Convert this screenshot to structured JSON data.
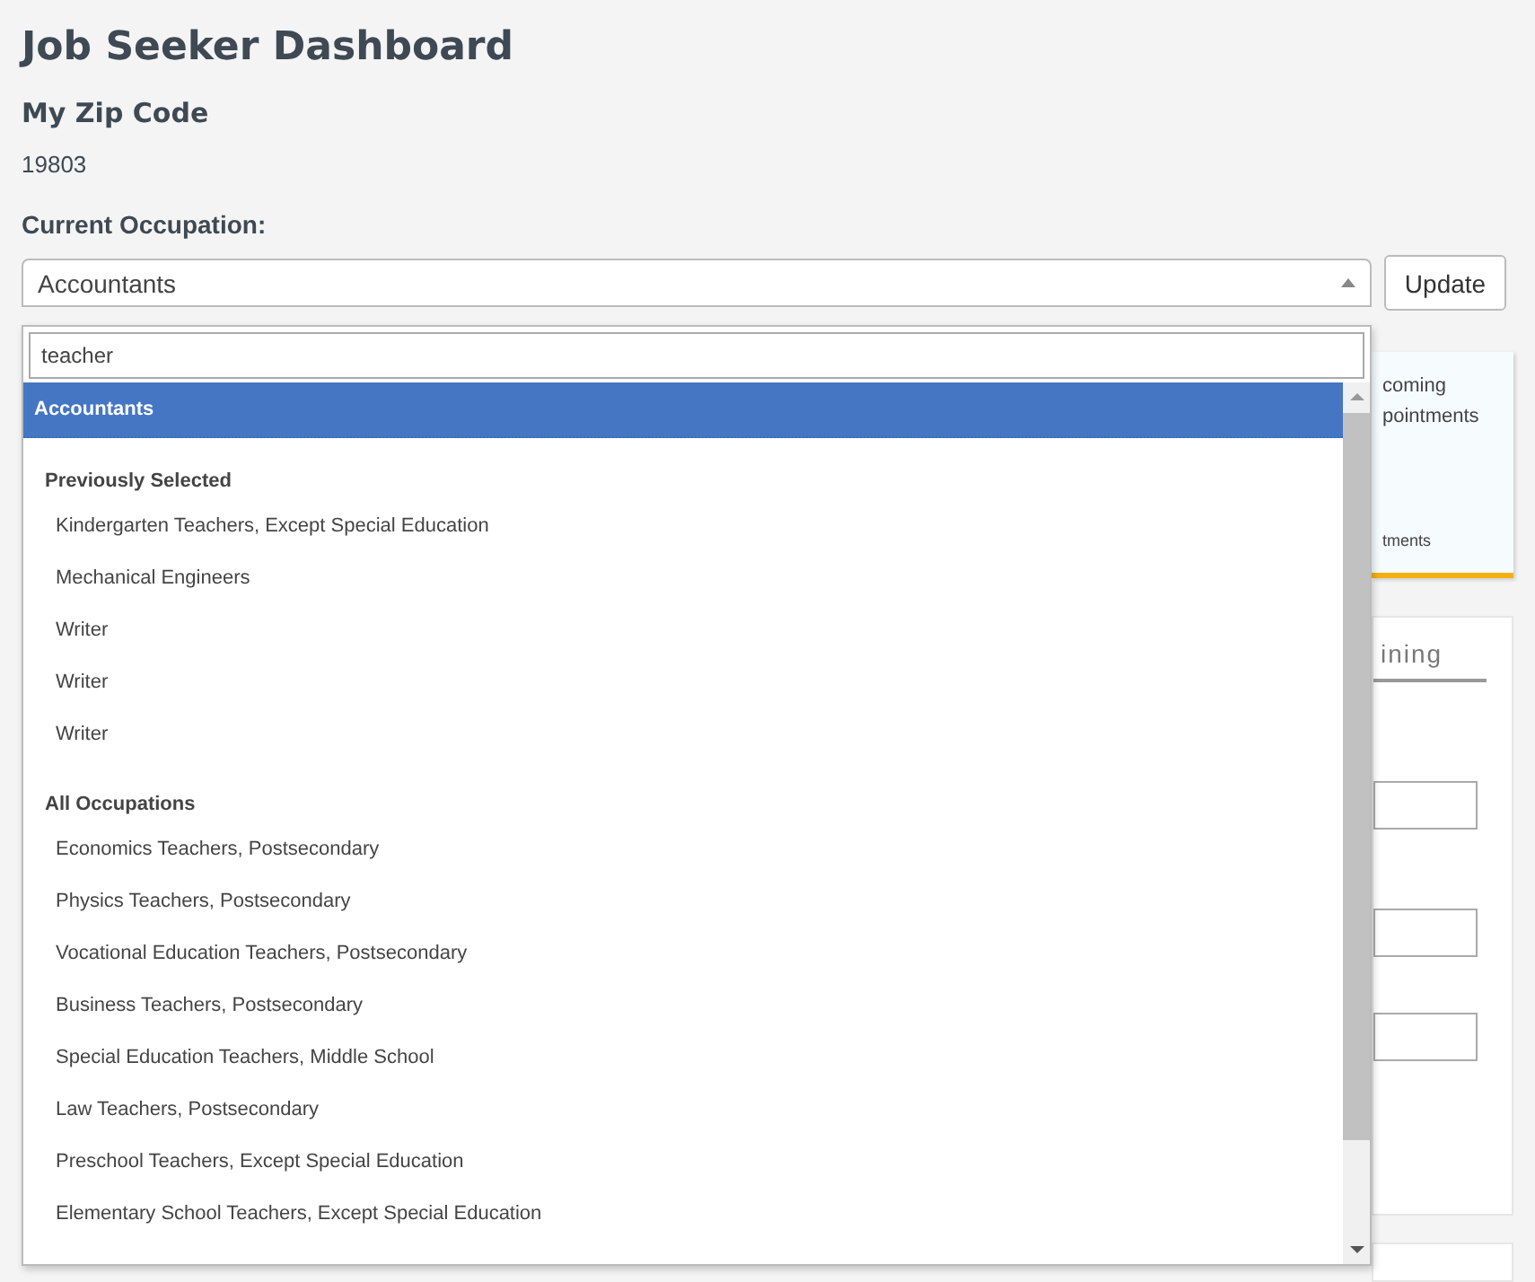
{
  "page": {
    "title": "Job Seeker Dashboard"
  },
  "zip": {
    "label": "My Zip Code",
    "value": "19803"
  },
  "occupation": {
    "label": "Current Occupation:",
    "value": "Accountants",
    "expanded": true,
    "search": "teacher",
    "current_option": {
      "label": "Accountants",
      "selected": true
    },
    "groups": [
      {
        "label": "Previously Selected",
        "options": [
          {
            "label": "Kindergarten Teachers, Except Special Education",
            "selected": false
          },
          {
            "label": "Mechanical Engineers",
            "selected": false
          },
          {
            "label": "Writer",
            "selected": false
          },
          {
            "label": "Writer",
            "selected": false
          },
          {
            "label": "Writer",
            "selected": false
          }
        ]
      },
      {
        "label": "All Occupations",
        "options": [
          {
            "label": "Economics Teachers, Postsecondary",
            "selected": false
          },
          {
            "label": "Physics Teachers, Postsecondary",
            "selected": false
          },
          {
            "label": "Vocational Education Teachers, Postsecondary",
            "selected": false
          },
          {
            "label": "Business Teachers, Postsecondary",
            "selected": false
          },
          {
            "label": "Special Education Teachers, Middle School",
            "selected": false
          },
          {
            "label": "Law Teachers, Postsecondary",
            "selected": false
          },
          {
            "label": "Preschool Teachers, Except Special Education",
            "selected": false
          },
          {
            "label": "Elementary School Teachers, Except Special Education",
            "selected": false
          }
        ]
      }
    ]
  },
  "update_button": "Update",
  "appointments_card": {
    "lines": [
      "coming",
      "pointments"
    ],
    "link": "tments"
  },
  "training_panel": {
    "tab": "ining"
  }
}
